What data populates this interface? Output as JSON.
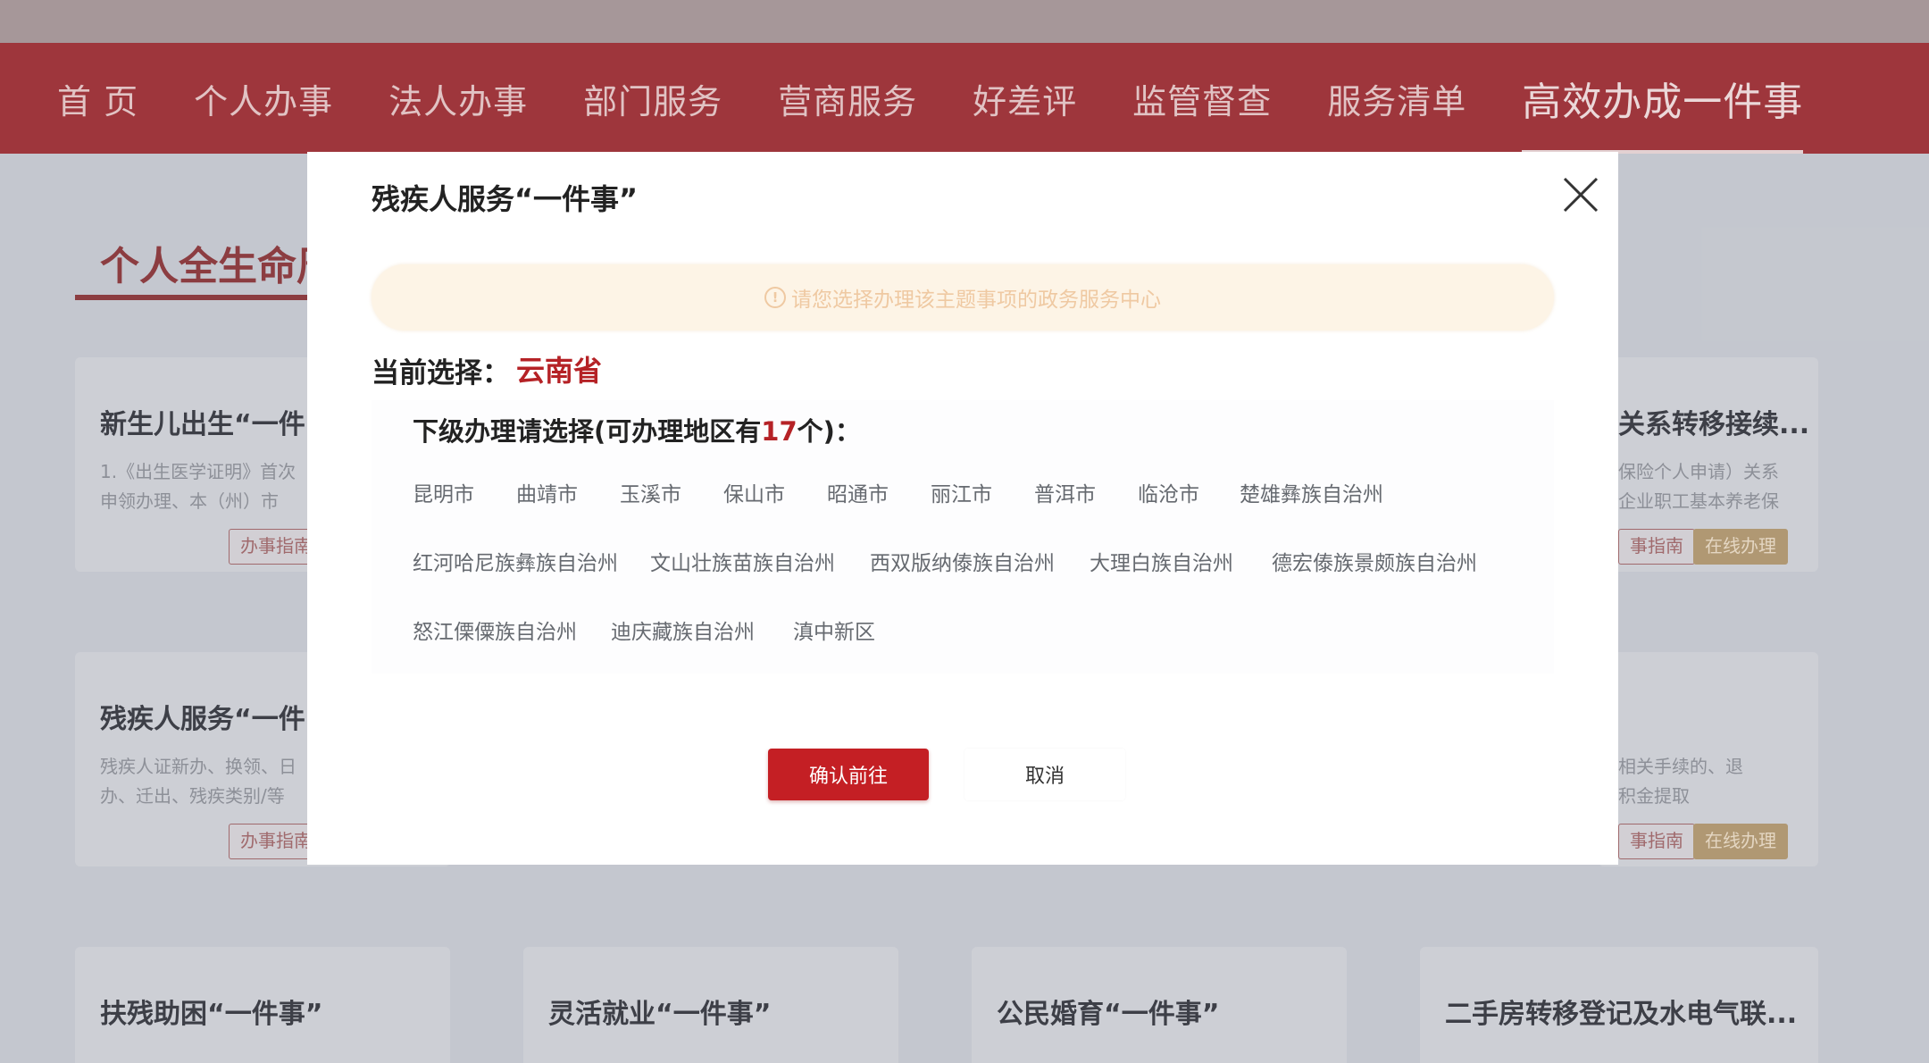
{
  "nav": {
    "items": [
      {
        "label": "首 页",
        "active": false
      },
      {
        "label": "个人办事",
        "active": false
      },
      {
        "label": "法人办事",
        "active": false
      },
      {
        "label": "部门服务",
        "active": false
      },
      {
        "label": "营商服务",
        "active": false
      },
      {
        "label": "好差评",
        "active": false
      },
      {
        "label": "监管督查",
        "active": false
      },
      {
        "label": "服务清单",
        "active": false
      },
      {
        "label": "高效办成一件事",
        "active": true
      }
    ]
  },
  "background": {
    "section_title": "个人全生命周",
    "cards": [
      {
        "title": "新生儿出生“一件",
        "text1": "1.《出生医学证明》首次",
        "text2": "申领办理、本（州）市",
        "btn": "办事指南"
      },
      {
        "title": "残疾人服务“一件",
        "text1": "残疾人证新办、换领、日",
        "text2": "办、迁出、残疾类别/等",
        "btn": "办事指南"
      },
      {
        "title": "扶残助困“一件事”"
      },
      {
        "title": "灵活就业“一件事”"
      },
      {
        "title": "公民婚育“一件事”"
      },
      {
        "title": "二手房转移登记及水电气联..."
      },
      {
        "title": "关系转移接续...",
        "text1": "保险个人申请）关系",
        "text2": "企业职工基本养老保",
        "btn1": "事指南",
        "btn2": "在线办理"
      },
      {
        "title": "",
        "text1": "相关手续的、退",
        "text2": "积金提取",
        "btn1": "事指南",
        "btn2": "在线办理"
      }
    ]
  },
  "modal": {
    "title": "残疾人服务“一件事”",
    "notice": "请您选择办理该主题事项的政务服务中心",
    "current_label": "当前选择：",
    "current_value": "云南省",
    "sub_title_prefix": "下级办理请选择(可办理地区有",
    "sub_title_count": "17",
    "sub_title_suffix": "个)：",
    "regions": [
      "昆明市",
      "曲靖市",
      "玉溪市",
      "保山市",
      "昭通市",
      "丽江市",
      "普洱市",
      "临沧市",
      "楚雄彝族自治州",
      "红河哈尼族彝族自治州",
      "文山壮族苗族自治州",
      "西双版纳傣族自治州",
      "大理白族自治州",
      "德宏傣族景颇族自治州",
      "怒江傈僳族自治州",
      "迪庆藏族自治州",
      "滇中新区"
    ],
    "confirm_label": "确认前往",
    "cancel_label": "取消"
  }
}
